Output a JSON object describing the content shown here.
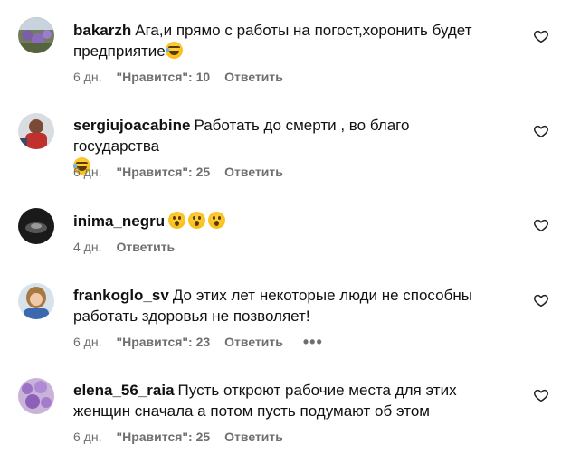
{
  "comments": [
    {
      "username": "bakarzh",
      "text": "Ага,и прямо с работы на погост,хоронить будет предприятие",
      "time": "6 дн.",
      "likes": "\"Нравится\": 10",
      "reply": "Ответить"
    },
    {
      "username": "sergiujoacabine",
      "text": "Работать до смерти , во благо государства",
      "time": "6 дн.",
      "likes": "\"Нравится\": 25",
      "reply": "Ответить"
    },
    {
      "username": "inima_negru",
      "text": "",
      "time": "4 дн.",
      "reply": "Ответить"
    },
    {
      "username": "frankoglo_sv",
      "text": "До этих лет некоторые люди не способны работать здоровья не позволяет!",
      "time": "6 дн.",
      "likes": "\"Нравится\": 23",
      "reply": "Ответить",
      "more": "•••"
    },
    {
      "username": "elena_56_raia",
      "text": "Пусть откроют рабочие места для этих женщин сначала а потом пусть подумают об этом",
      "time": "6 дн.",
      "likes": "\"Нравится\": 25",
      "reply": "Ответить"
    }
  ],
  "icons": {
    "like": "heart-outline-icon",
    "laugh": "laughing-tears-emoji",
    "wow": "surprised-face-emoji"
  }
}
